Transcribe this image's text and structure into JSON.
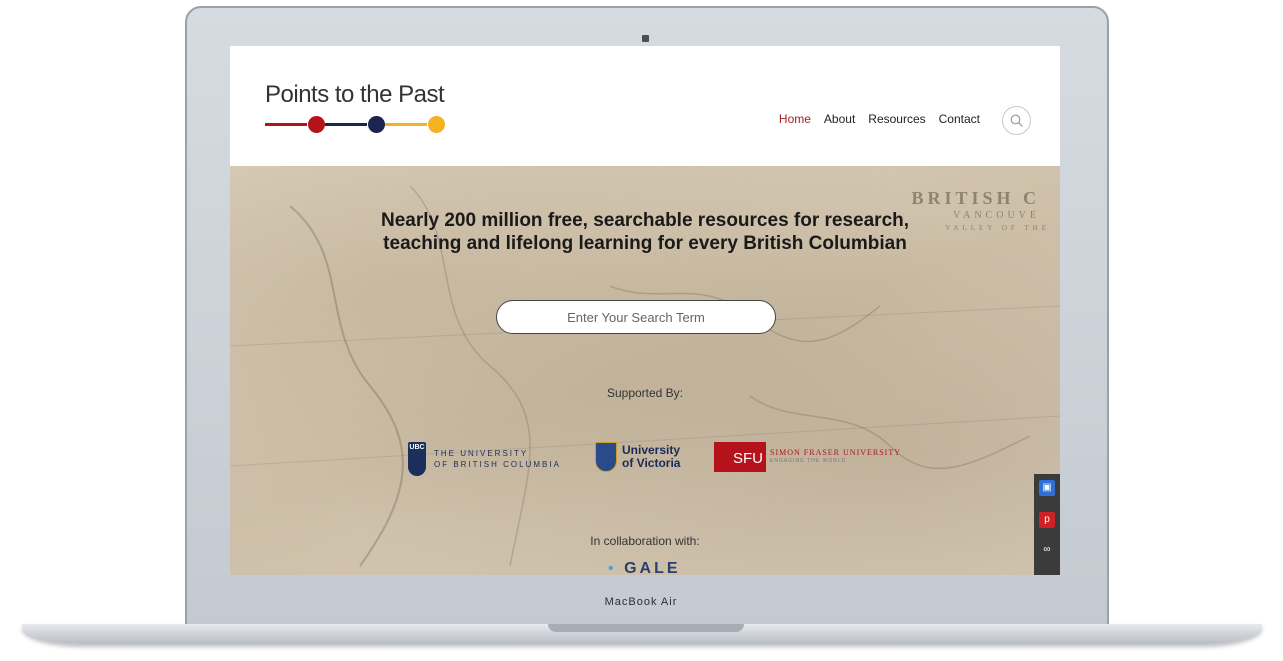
{
  "site": {
    "title": "Points to the Past",
    "pointers": [
      {
        "color": "#b5121b"
      },
      {
        "color": "#1c2450"
      },
      {
        "color": "#f5b324"
      }
    ]
  },
  "nav": {
    "items": [
      {
        "label": "Home",
        "active": true
      },
      {
        "label": "About",
        "active": false
      },
      {
        "label": "Resources",
        "active": false
      },
      {
        "label": "Contact",
        "active": false
      }
    ]
  },
  "hero": {
    "headline_line1": "Nearly 200 million free, searchable resources for research,",
    "headline_line2": "teaching and lifelong learning for every British Columbian",
    "search_placeholder": "Enter Your Search Term",
    "map_labels": [
      "BRITISH C",
      "VANCOUVE",
      "VALLEY OF THE"
    ],
    "supported_by": "Supported By:",
    "collaboration": "In collaboration with:"
  },
  "partners": {
    "ubc": {
      "crest": "UBC",
      "line1": "THE UNIVERSITY",
      "line2": "OF BRITISH COLUMBIA"
    },
    "uvic": {
      "line1": "University",
      "line2": "of Victoria"
    },
    "sfu": {
      "box": "SFU",
      "line1": "SIMON FRASER UNIVERSITY",
      "line2": "ENGAGING THE WORLD"
    },
    "gale": {
      "label": "GALE"
    }
  },
  "side_toolbar": {
    "buttons": [
      {
        "icon": "bookmark-icon",
        "color": "#2f6fd6"
      },
      {
        "icon": "pinterest-icon",
        "color": "#cf2126"
      },
      {
        "icon": "link-icon",
        "color": "#3b3b3b"
      }
    ]
  },
  "device": {
    "brand_text": "MacBook Air"
  },
  "colors": {
    "accent": "#a32024",
    "sfu_red": "#b5121b",
    "ubc_blue": "#1c2e5c"
  }
}
